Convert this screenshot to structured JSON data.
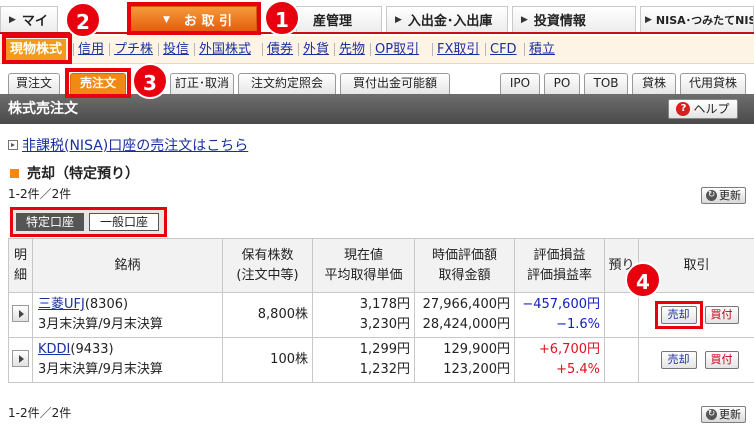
{
  "topnav": {
    "tabs": [
      {
        "label": "マイ"
      },
      {
        "label": "お 取 引"
      },
      {
        "label": "産管理"
      },
      {
        "label": "入出金･入出庫"
      },
      {
        "label": "投資情報"
      },
      {
        "label": "NISA･つみたてNISA"
      }
    ]
  },
  "subnav": {
    "items": [
      "現物株式",
      "信用",
      "プチ株",
      "投信",
      "外国株式",
      "債券",
      "外貨",
      "先物",
      "OP取引",
      "FX取引",
      "CFD",
      "積立"
    ]
  },
  "ordertabs": {
    "left": [
      "買注文",
      "売注文",
      "訂正･取消",
      "注文約定照会",
      "買付出金可能額"
    ],
    "right": [
      "IPO",
      "PO",
      "TOB",
      "貸株",
      "代用貸株"
    ]
  },
  "section": {
    "title": "株式売注文",
    "help_label": "ヘルプ",
    "help_icon": "?"
  },
  "nisa_link": "非課税(NISA)口座の売注文はこちら",
  "sell_heading": "売却（特定預り）",
  "count_text": "1-2件／2件",
  "refresh_label": "更新",
  "refresh_icon": "↻",
  "account": {
    "tokutei": "特定口座",
    "ippan": "一般口座"
  },
  "table": {
    "headers": [
      "明細",
      "銘柄",
      "保有株数(注文中等)",
      "現在値 平均取得単価",
      "時価評価額 取得金額",
      "評価損益 評価損益率",
      "預り",
      "取引"
    ],
    "header_lines": {
      "toggle": [
        "明",
        "細"
      ],
      "name": [
        "銘柄"
      ],
      "qty": [
        "保有株数",
        "(注文中等)"
      ],
      "price": [
        "現在値",
        "平均取得単価"
      ],
      "value": [
        "時価評価額",
        "取得金額"
      ],
      "pl": [
        "評価損益",
        "評価損益率"
      ],
      "azukari": [
        "預り"
      ],
      "actions": [
        "取引"
      ]
    },
    "rows": [
      {
        "name": "三菱UFJ",
        "code": "(8306)",
        "settle": "3月末決算/9月末決算",
        "qty": "8,800株",
        "current": "3,178円",
        "avg": "3,230円",
        "mkt_value": "27,966,400円",
        "cost": "28,424,000円",
        "pl": "−457,600円",
        "pl_rate": "−1.6%",
        "sell": "売却",
        "buy": "買付"
      },
      {
        "name": "KDDI",
        "code": "(9433)",
        "settle": "3月末決算/9月末決算",
        "qty": "100株",
        "current": "1,299円",
        "avg": "1,232円",
        "mkt_value": "129,900円",
        "cost": "123,200円",
        "pl": "+6,700円",
        "pl_rate": "+5.4%",
        "sell": "売却",
        "buy": "買付"
      }
    ]
  },
  "markers": [
    "1",
    "2",
    "3",
    "4"
  ],
  "colors": {
    "accent": "#e8000f",
    "orange": "#f08a12",
    "link": "#1a2fa0",
    "negative": "#1020c0",
    "positive": "#e0101e"
  }
}
